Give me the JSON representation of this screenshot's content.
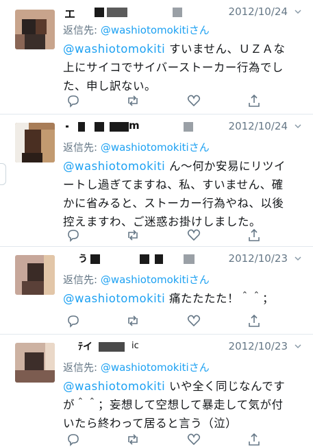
{
  "tweets": [
    {
      "date": "2012/10/24",
      "reply_prefix": "返信先: ",
      "reply_handle": "@washiotomokitiさん",
      "mention": "@washiotomokiti",
      "lines": [
        "すいません、ＵＺＡな",
        "上にサイコでサイバーストーカー行為でし",
        "た、申し訳ない。"
      ]
    },
    {
      "date": "2012/10/24",
      "reply_prefix": "返信先: ",
      "reply_handle": "@washiotomokitiさん",
      "mention": "@washiotomokiti",
      "lines": [
        "ん〜何か安易にリツイ",
        "ートし過ぎてますね、私、すいません、確",
        "かに省みると、ストーカー行為やね、以後",
        "控えますわ、ご迷惑お掛けしました。"
      ]
    },
    {
      "date": "2012/10/23",
      "reply_prefix": "返信先: ",
      "reply_handle": "@washiotomokitiさん",
      "mention": "@washiotomokiti",
      "lines": [
        "痛たたたた！＾＾；"
      ]
    },
    {
      "date": "2012/10/23",
      "reply_prefix": "返信先: ",
      "reply_handle": "@washiotomokitiさん",
      "mention": "@washiotomokiti",
      "lines": [
        "いや全く同じなんです",
        "が＾＾；妄想して空想して暴走して気が付",
        "いたら終わって居ると言う（泣）"
      ]
    }
  ],
  "header_texts": [
    "エ",
    "m",
    "う",
    "ﾃイ",
    "ic"
  ],
  "icons": [
    "reply-icon",
    "retweet-icon",
    "like-icon",
    "share-icon",
    "chevron-down-icon"
  ]
}
